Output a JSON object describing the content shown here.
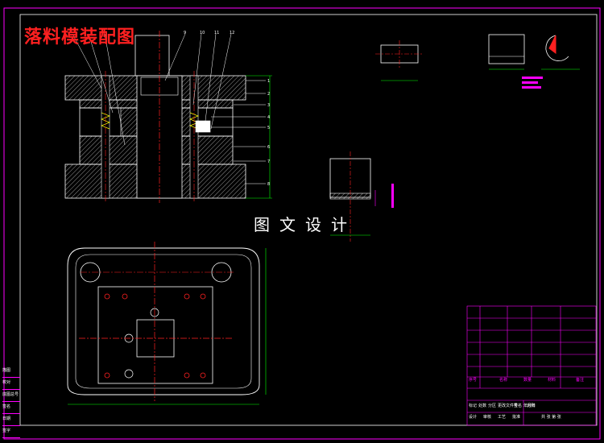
{
  "drawing": {
    "title": "落料模装配图",
    "watermark": "图文设计",
    "part_numbers": [
      "1",
      "2",
      "3",
      "4",
      "5",
      "6",
      "7",
      "8",
      "9",
      "10",
      "11",
      "12"
    ],
    "side_labels": [
      "描图",
      "校对",
      "底图总号",
      "签名",
      "日期",
      "签字"
    ],
    "colors": {
      "background": "#000000",
      "outline": "#ffffff",
      "centerline": "#ff2020",
      "dimension": "#00ff00",
      "frame": "#ff00ff",
      "hatch": "#ffffff",
      "accent": "#ffff00"
    },
    "title_block": {
      "rows": [
        "序号",
        "名称",
        "数量",
        "材料",
        "备注"
      ],
      "labels": [
        "标记",
        "处数",
        "分区",
        "更改文件号",
        "签名",
        "年月日"
      ],
      "footer": [
        "设计",
        "审核",
        "工艺",
        "批准"
      ],
      "scale_label": "比例",
      "sheet_label": "共 张 第 张"
    }
  }
}
